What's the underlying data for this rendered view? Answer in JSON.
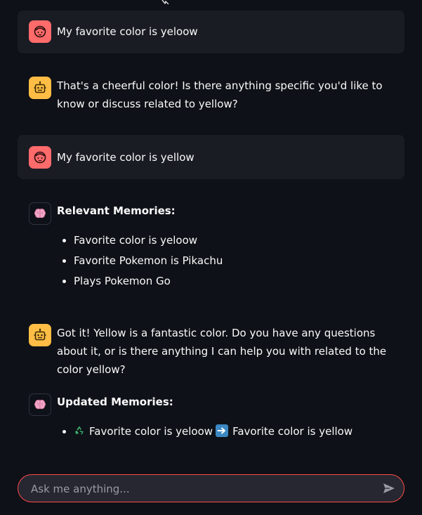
{
  "messages": [
    {
      "role": "user",
      "avatar_icon": "user-face-icon",
      "text": "My favorite color is yeloow"
    },
    {
      "role": "assistant",
      "avatar_icon": "robot-icon",
      "text": "That's a cheerful color! Is there anything specific you'd like to know or discuss related to yellow?"
    },
    {
      "role": "user",
      "avatar_icon": "user-face-icon",
      "text": "My favorite color is yellow"
    },
    {
      "role": "memory",
      "avatar_icon": "brain-icon",
      "heading": "Relevant Memories:",
      "items": [
        "Favorite color is yeloow",
        "Favorite Pokemon is Pikachu",
        "Plays Pokemon Go"
      ]
    },
    {
      "role": "assistant",
      "avatar_icon": "robot-icon",
      "text": "Got it! Yellow is a fantastic color. Do you have any questions about it, or is there anything I can help you with related to the color yellow?"
    },
    {
      "role": "memory",
      "avatar_icon": "brain-icon",
      "heading": "Updated Memories:",
      "update": {
        "icon_before": "recycle-icon",
        "old": "Favorite color is yeloow",
        "icon_between": "right-arrow-icon",
        "new": "Favorite color is yellow"
      }
    }
  ],
  "chat_input": {
    "placeholder": "Ask me anything...",
    "value": "",
    "send_icon": "send-icon"
  },
  "colors": {
    "background": "#0e1117",
    "user_message_bg": "#1a1c24",
    "user_avatar": "#ff6b6b",
    "assistant_avatar": "#ffbd45",
    "input_border": "#ff4b4b",
    "input_bg": "#262730"
  }
}
